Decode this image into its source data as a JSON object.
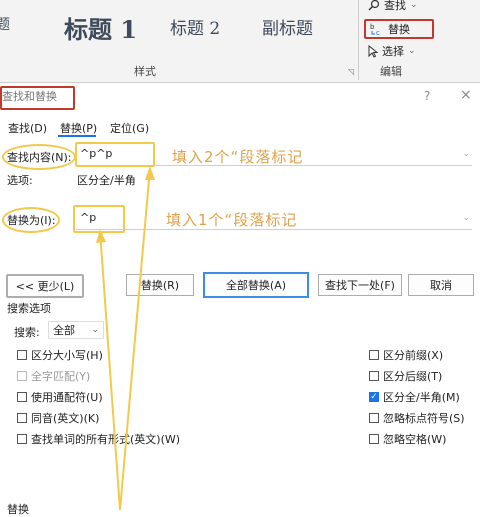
{
  "ribbon": {
    "styles": [
      {
        "label": "题",
        "size": 14
      },
      {
        "label": "标题 1",
        "size": 24
      },
      {
        "label": "标题 2",
        "size": 17
      },
      {
        "label": "副标题",
        "size": 17
      }
    ],
    "styles_group_label": "样式",
    "find_label": "查找",
    "replace_label": "替换",
    "select_label": "选择",
    "edit_group_label": "编辑",
    "dropdown_glyph": "⌄"
  },
  "dialog": {
    "title": "查找和替换",
    "help": "?",
    "close": "×",
    "tabs": [
      "查找(D)",
      "替换(P)",
      "定位(G)"
    ],
    "find_label": "查找内容(N):",
    "find_value": "^p^p",
    "options_label": "选项:",
    "options_value": "区分全/半角",
    "replace_label": "替换为(I):",
    "replace_value": "^p",
    "buttons": {
      "less": "<< 更少(L)",
      "replace": "替换(R)",
      "replace_all": "全部替换(A)",
      "find_next": "查找下一处(F)",
      "cancel": "取消"
    },
    "search_options_title": "搜索选项",
    "search_label": "搜索:",
    "search_value": "全部",
    "left_checks": [
      {
        "label": "区分大小写(H)",
        "checked": false,
        "disabled": false
      },
      {
        "label": "全字匹配(Y)",
        "checked": false,
        "disabled": true
      },
      {
        "label": "使用通配符(U)",
        "checked": false,
        "disabled": false
      },
      {
        "label": "同音(英文)(K)",
        "checked": false,
        "disabled": false
      },
      {
        "label": "查找单词的所有形式(英文)(W)",
        "checked": false,
        "disabled": false
      }
    ],
    "right_checks": [
      {
        "label": "区分前缀(X)",
        "checked": false
      },
      {
        "label": "区分后缀(T)",
        "checked": false
      },
      {
        "label": "区分全/半角(M)",
        "checked": true
      },
      {
        "label": "忽略标点符号(S)",
        "checked": false
      },
      {
        "label": "忽略空格(W)",
        "checked": false
      }
    ],
    "bottom_label": "替换"
  },
  "annotations": {
    "find_hint": "填入2个“段落标记",
    "replace_hint": "填入1个“段落标记"
  },
  "colors": {
    "annotation_red": "#c0392b",
    "annotation_yellow": "#f2c94c",
    "hint_text": "#e0a24a",
    "primary_blue": "#3a8ee6",
    "checkbox_checked": "#1a73e8"
  }
}
